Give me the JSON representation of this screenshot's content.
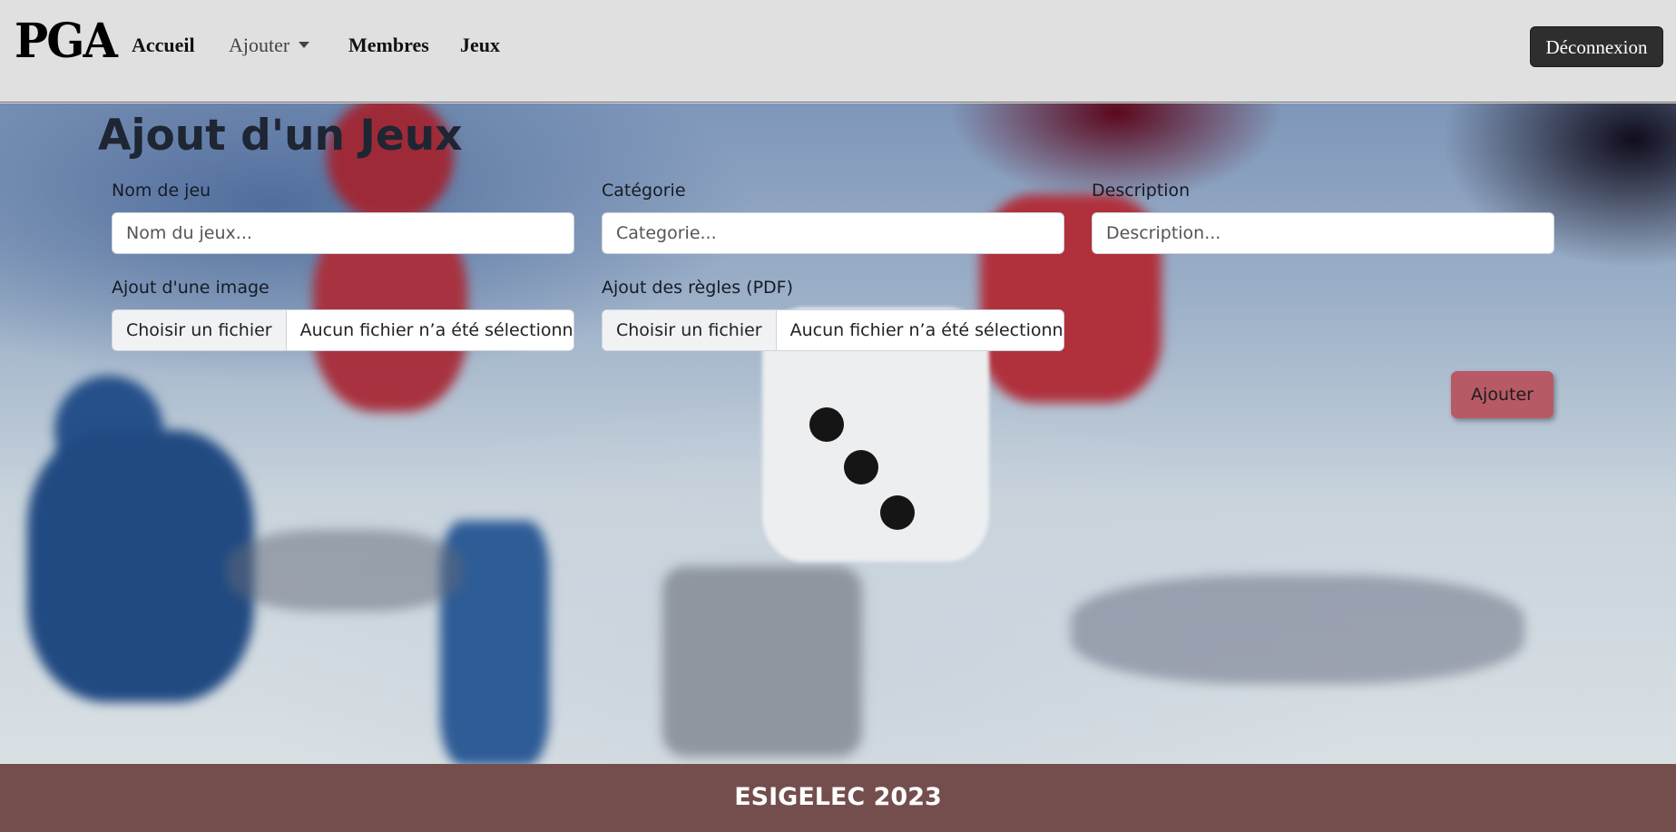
{
  "navbar": {
    "logo_text": "PGA",
    "links": [
      "Accueil",
      "Ajouter",
      "Membres",
      "Jeux"
    ],
    "logout_label": "Déconnexion"
  },
  "form": {
    "title": "Ajout d'un Jeux",
    "name_label": "Nom de jeu",
    "name_placeholder": "Nom du jeux...",
    "category_label": "Catégorie",
    "category_placeholder": "Categorie...",
    "description_label": "Description",
    "description_placeholder": "Description...",
    "image_label": "Ajout d'une image",
    "rules_label": "Ajout des règles (PDF)",
    "file_button": "Choisir un fichier",
    "file_none": "Aucun fichier n’a été sélectionné",
    "submit_label": "Ajouter"
  },
  "footer": {
    "text": "ESIGELEC 2023"
  },
  "colors": {
    "navbar_bg": "#e0e0e0",
    "logout_bg": "#2e2e2e",
    "submit_bg": "#b85a66",
    "footer_bg": "#744d4d"
  }
}
